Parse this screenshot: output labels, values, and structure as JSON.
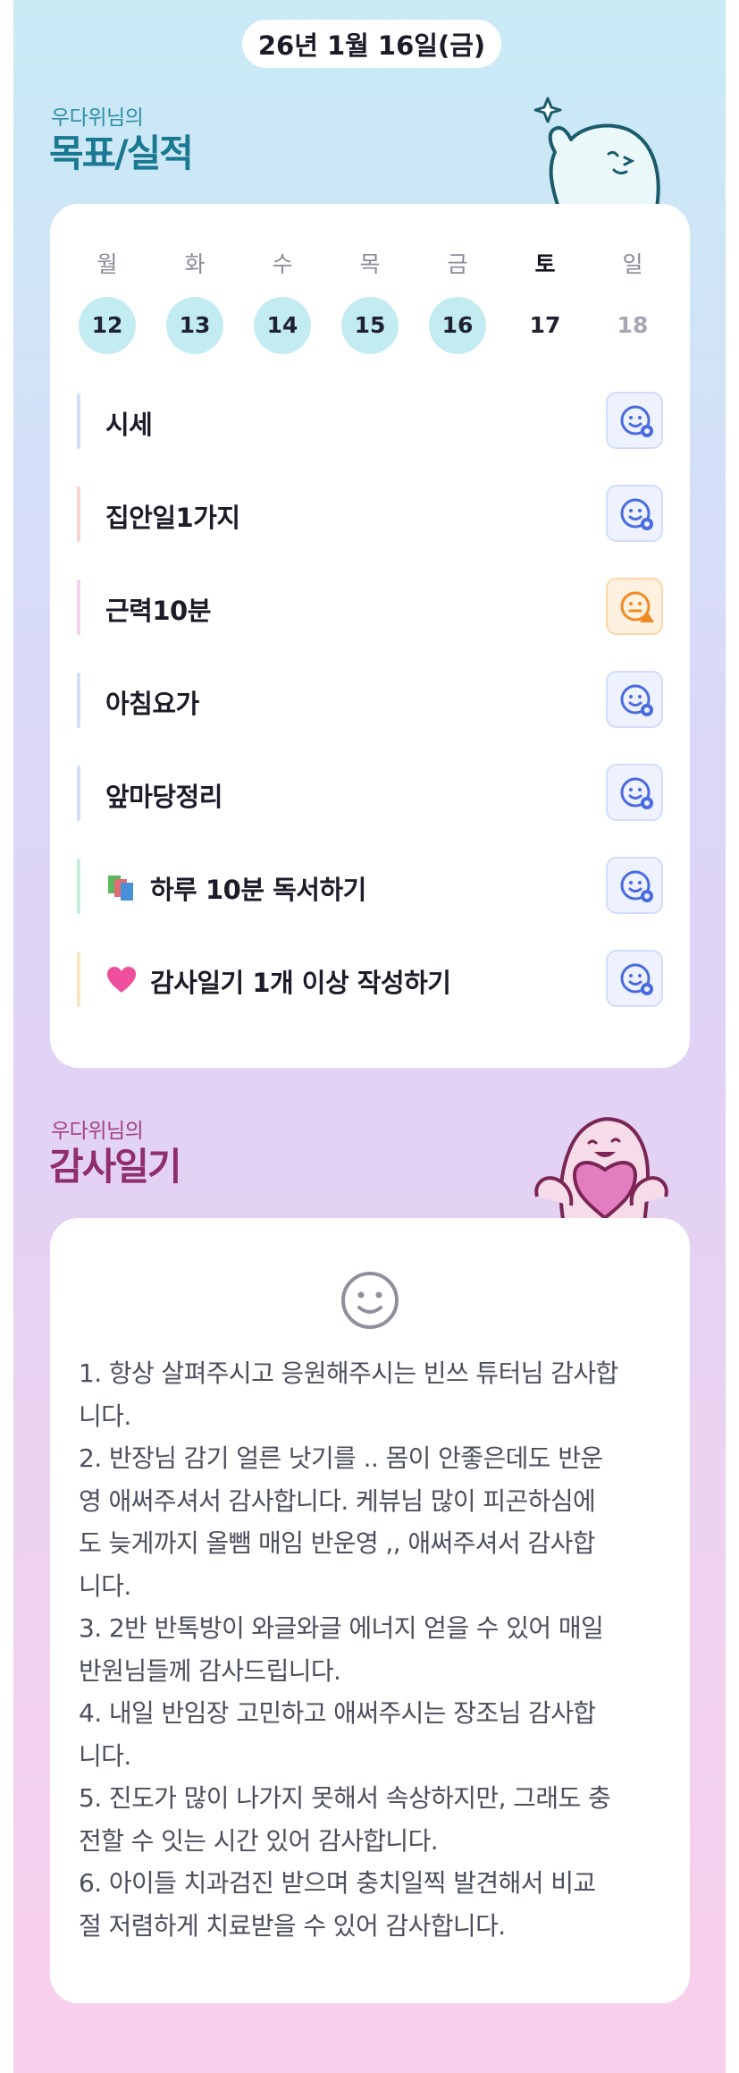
{
  "header": {
    "date": "26년 1월 16일(금)"
  },
  "goals_section": {
    "owner_label": "우다위님의",
    "title": "목표/실적"
  },
  "week": [
    {
      "day": "월",
      "date": "12",
      "state": "done"
    },
    {
      "day": "화",
      "date": "13",
      "state": "done"
    },
    {
      "day": "수",
      "date": "14",
      "state": "done"
    },
    {
      "day": "목",
      "date": "15",
      "state": "done"
    },
    {
      "day": "금",
      "date": "16",
      "state": "done"
    },
    {
      "day": "토",
      "date": "17",
      "state": "today"
    },
    {
      "day": "일",
      "date": "18",
      "state": "future"
    }
  ],
  "goals": [
    {
      "label": "시세",
      "bar_color": "#d4def9",
      "status": "done",
      "emoji": ""
    },
    {
      "label": "집안일1가지",
      "bar_color": "#f9d2d2",
      "status": "done",
      "emoji": ""
    },
    {
      "label": "근력10분",
      "bar_color": "#f6d2ee",
      "status": "warning",
      "emoji": ""
    },
    {
      "label": "아침요가",
      "bar_color": "#d4def9",
      "status": "done",
      "emoji": ""
    },
    {
      "label": "앞마당정리",
      "bar_color": "#d4def9",
      "status": "done",
      "emoji": ""
    },
    {
      "label": "하루 10분 독서하기",
      "bar_color": "#c9efdb",
      "status": "done",
      "emoji": "books-icon"
    },
    {
      "label": "감사일기 1개 이상 작성하기",
      "bar_color": "#fbe6c4",
      "status": "done",
      "emoji": "pink-heart-icon"
    }
  ],
  "gratitude_section": {
    "owner_label": "우다위님의",
    "title": "감사일기"
  },
  "gratitude_journal": {
    "lines": [
      "1. 항상 살펴주시고 응원해주시는 빈쓰 튜터님 감사합",
      "니다.",
      "2. 반장님 감기 얼른 낫기를 .. 몸이 안좋은데도 반운",
      "영 애써주셔서 감사합니다. 케뷰님 많이 피곤하심에",
      "도 늦게까지 올뺌 매임 반운영 ,, 애써주셔서 감사합",
      "니다.",
      "3. 2반 반톡방이 와글와글 에너지 얻을 수 있어 매일",
      "반원님들께 감사드립니다.",
      "4. 내일 반임장 고민하고 애써주시는 장조님 감사합",
      "니다.",
      "5. 진도가 많이 나가지 못해서 속상하지만, 그래도 충",
      "전할 수 잇는 시간 있어 감사합니다.",
      "6. 아이들 치과검진 받으며 충치일찍 발견해서 비교",
      "절 저렴하게 치료받을 수 있어 감사합니다."
    ]
  }
}
